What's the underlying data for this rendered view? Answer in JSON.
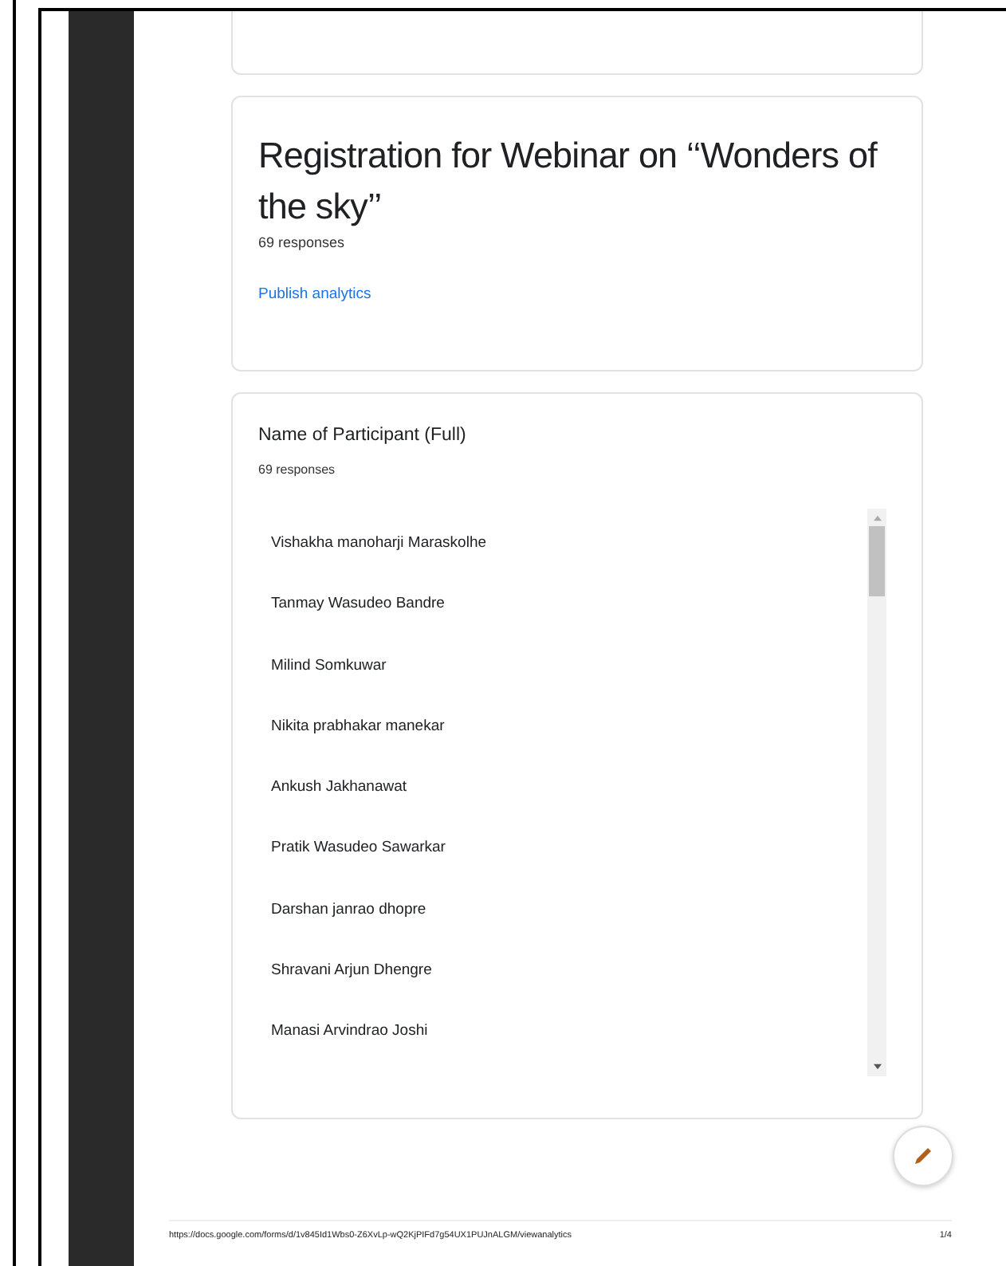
{
  "form": {
    "title": "Registration for Webinar on ‘‘Wonders of the sky’’",
    "responses": "69 responses",
    "publish_link": "Publish analytics"
  },
  "question": {
    "title": "Name of Participant (Full)",
    "responses": "69 responses",
    "answers": [
      "Vishakha manoharji Maraskolhe",
      "Tanmay Wasudeo Bandre",
      "Milind Somkuwar",
      "Nikita prabhakar manekar",
      "Ankush Jakhanawat",
      "Pratik Wasudeo Sawarkar",
      "Darshan janrao dhopre",
      "Shravani Arjun Dhengre",
      "Manasi Arvindrao Joshi"
    ]
  },
  "footer": {
    "url": "https://docs.google.com/forms/d/1v845Id1Wbs0-Z6XvLp-wQ2KjPIFd7g54UX1PUJnALGM/viewanalytics",
    "page": "1/4"
  }
}
